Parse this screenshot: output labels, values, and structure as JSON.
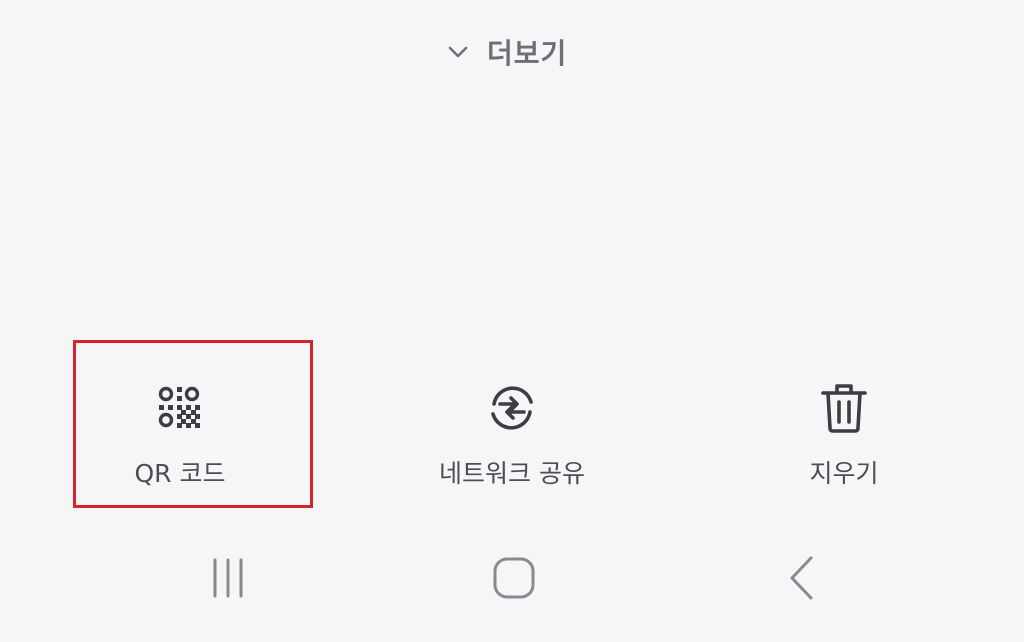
{
  "more": {
    "label": "더보기"
  },
  "actions": [
    {
      "label": "QR 코드",
      "icon": "qr-code-icon"
    },
    {
      "label": "네트워크 공유",
      "icon": "network-share-icon"
    },
    {
      "label": "지우기",
      "icon": "trash-icon"
    }
  ],
  "navbar": {
    "recents_icon": "recents-icon",
    "home_icon": "home-icon",
    "back_icon": "back-icon"
  },
  "colors": {
    "background": "#f6f5f8",
    "highlight": "#d9232a",
    "icon": "#3d3d42"
  }
}
